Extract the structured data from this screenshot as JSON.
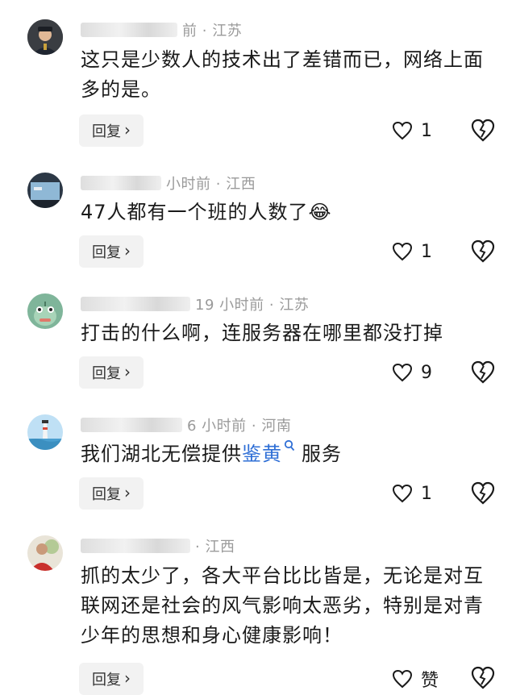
{
  "comments": [
    {
      "avatar": "avatar-police-uniform",
      "user_tail": "前",
      "location": "江苏",
      "text": "这只是少数人的技术出了差错而已，网络上面多的是。",
      "reply_label": "回复",
      "likes": "1"
    },
    {
      "avatar": "avatar-blue-screen",
      "time": "小时前",
      "location": "江西",
      "text": "47人都有一个班的人数了",
      "emoji": "😂",
      "reply_label": "回复",
      "likes": "1"
    },
    {
      "avatar": "avatar-green-monster",
      "time": "19 小时前",
      "location": "江苏",
      "text": "打击的什么啊，连服务器在哪里都没打掉",
      "reply_label": "回复",
      "likes": "9"
    },
    {
      "avatar": "avatar-lighthouse",
      "time": "6 小时前",
      "location": "河南",
      "text_before": "我们湖北无偿提供",
      "keyword": "鉴黄",
      "text_after": "服务",
      "reply_label": "回复",
      "likes": "1"
    },
    {
      "avatar": "avatar-person-red",
      "location": "江西",
      "text": "抓的太少了，各大平台比比皆是，无论是对互联网还是社会的风气影响太恶劣，特别是对青少年的思想和身心健康影响！",
      "reply_label": "回复",
      "likes": "赞"
    }
  ],
  "separator": "·"
}
